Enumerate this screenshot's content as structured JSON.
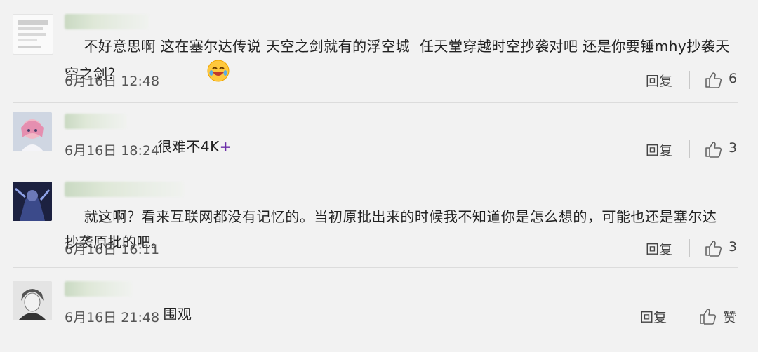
{
  "comments": [
    {
      "text": "不好意思啊 这在塞尔达传说 天空之剑就有的浮空城  任天堂穿越时空抄袭对吧 还是你要锤mhy抄袭天空之剑？",
      "emoji": "laughing-tears-emoji",
      "time": "6月16日 12:48",
      "reply_label": "回复",
      "likes": "6"
    },
    {
      "text": "很难不4K",
      "suffix": "+",
      "time": "6月16日 18:24",
      "reply_label": "回复",
      "likes": "3"
    },
    {
      "text": "就这啊？看来互联网都没有记忆的。当初原批出来的时候我不知道你是怎么想的，可能也还是塞尔达抄袭原批的吧。",
      "time": "6月16日 16:11",
      "reply_label": "回复",
      "likes": "3"
    },
    {
      "text": "围观",
      "time": "6月16日 21:48",
      "reply_label": "回复",
      "likes": "赞"
    }
  ],
  "colors": {
    "background": "#f2f2f2",
    "text": "#222222",
    "meta": "#555555",
    "plus": "#6b2ea8"
  },
  "icons": [
    "thumbs-up-icon",
    "laughing-tears-emoji"
  ]
}
